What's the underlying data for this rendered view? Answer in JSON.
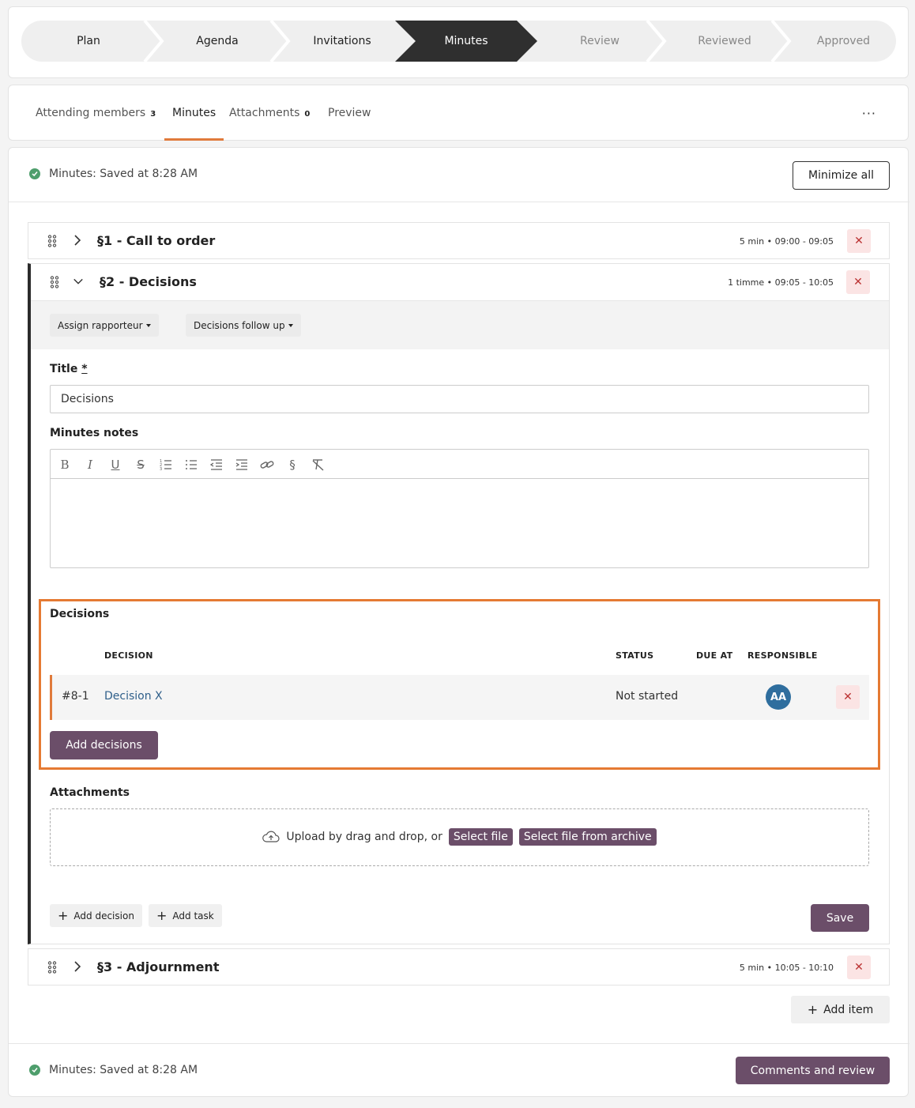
{
  "stepper": {
    "steps": [
      {
        "label": "Plan",
        "state": "done"
      },
      {
        "label": "Agenda",
        "state": "done"
      },
      {
        "label": "Invitations",
        "state": "done"
      },
      {
        "label": "Minutes",
        "state": "current"
      },
      {
        "label": "Review",
        "state": "todo"
      },
      {
        "label": "Reviewed",
        "state": "todo"
      },
      {
        "label": "Approved",
        "state": "todo"
      }
    ]
  },
  "tabs": {
    "attending": {
      "label": "Attending members",
      "count": "3"
    },
    "minutes": {
      "label": "Minutes"
    },
    "attachments": {
      "label": "Attachments",
      "count": "0"
    },
    "preview": {
      "label": "Preview"
    },
    "more": "···"
  },
  "status": {
    "saved_top": "Minutes: Saved at 8:28 AM",
    "saved_bottom": "Minutes: Saved at 8:28 AM"
  },
  "minimize_label": "Minimize all",
  "items": [
    {
      "title": "§1 - Call to order",
      "time": "5 min • 09:00 - 09:05",
      "expanded": false
    },
    {
      "title": "§2 - Decisions",
      "time": "1 timme • 09:05 - 10:05",
      "expanded": true
    },
    {
      "title": "§3 - Adjournment",
      "time": "5 min • 10:05 - 10:10",
      "expanded": false
    }
  ],
  "item2": {
    "assign_rapporteur": "Assign rapporteur",
    "decisions_follow_up": "Decisions follow up",
    "title_label": "Title",
    "required_mark": "*",
    "title_value": "Decisions",
    "notes_label": "Minutes notes",
    "toolbar_icons": [
      "bold-icon",
      "italic-icon",
      "underline-icon",
      "strikethrough-icon",
      "ordered-list-icon",
      "bullet-list-icon",
      "outdent-icon",
      "indent-icon",
      "link-icon",
      "section-icon",
      "clear-format-icon"
    ],
    "decisions_section": {
      "label": "Decisions",
      "headers": {
        "decision": "DECISION",
        "status": "STATUS",
        "due_at": "DUE AT",
        "responsible": "RESPONSIBLE"
      },
      "rows": [
        {
          "id": "#8-1",
          "name": "Decision X",
          "status": "Not started",
          "due_at": "",
          "responsible_initials": "AA"
        }
      ],
      "add_label": "Add decisions"
    },
    "attachments": {
      "label": "Attachments",
      "upload_text": "Upload by drag and drop, or",
      "select_file": "Select file",
      "select_archive": "Select file from archive"
    },
    "add_decision": "Add decision",
    "add_task": "Add task",
    "save": "Save"
  },
  "add_item": "Add item",
  "comments_review": "Comments and review",
  "colors": {
    "accent": "#e07a3b",
    "primary": "#6b4e69",
    "success": "#4e9e6c",
    "avatar": "#2f6e9e",
    "dark": "#2f2f2f"
  }
}
